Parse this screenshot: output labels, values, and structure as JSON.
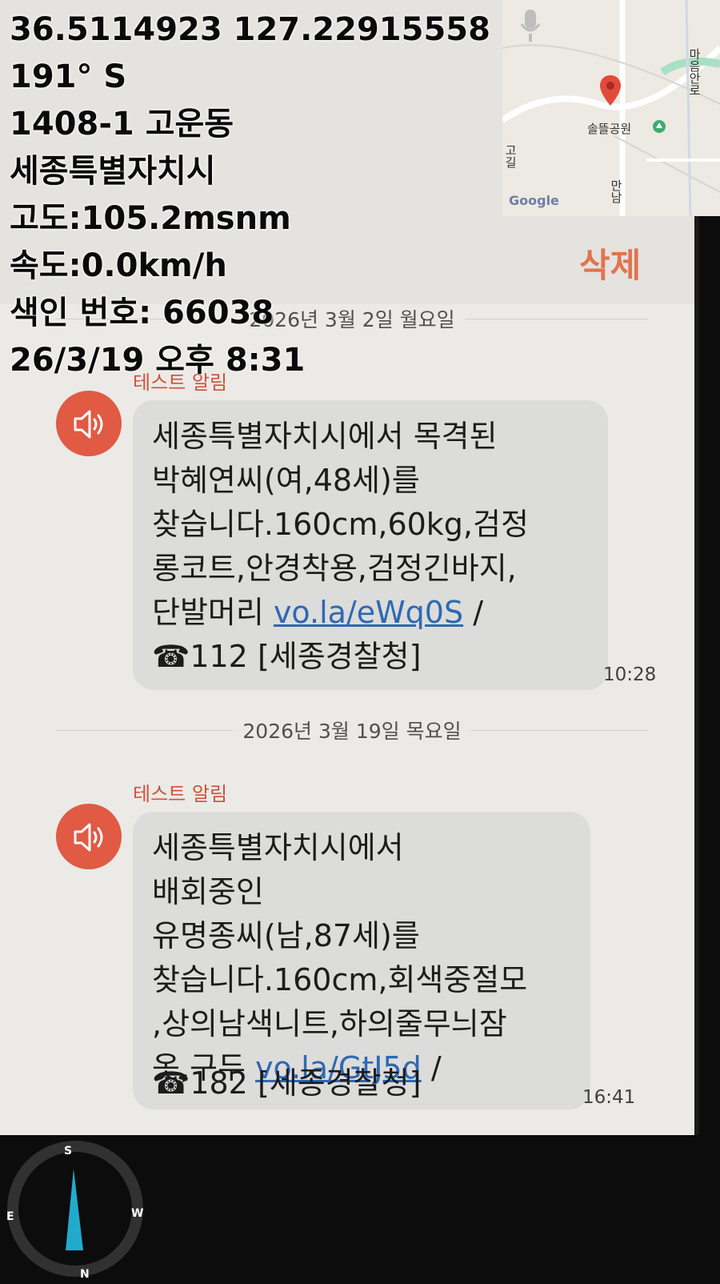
{
  "overlay": {
    "coordinates": "36.5114923 127.22915558",
    "heading": "191° S",
    "address": "1408-1 고운동",
    "city": "세종특별자치시",
    "altitude": "고도:105.2msnm",
    "speed": "속도:0.0km/h",
    "index": "색인 번호: 66038",
    "datetime": "26/3/19 오후 8:31"
  },
  "map": {
    "brand": "Google",
    "place": "솔뜰공원",
    "road_labels": [
      "마음안로",
      "고길",
      "만남"
    ]
  },
  "header": {
    "delete_label": "삭제"
  },
  "messages": [
    {
      "date": "2026년 3월 2일 월요일",
      "sender": "테스트 알림",
      "lines": [
        "세종특별자치시에서 목격된",
        "박혜연씨(여,48세)를",
        "찾습니다.160cm,60kg,검정",
        "롱코트,안경착용,검정긴바지,"
      ],
      "last_prefix": "단발머리",
      "link": "vo.la/eWq0S",
      "last_suffix": "/",
      "phone": "☎112 [세종경찰청]",
      "time": "10:28"
    },
    {
      "date": "2026년 3월 19일 목요일",
      "sender": "테스트 알림",
      "lines": [
        "세종특별자치시에서",
        "배회중인",
        "유명종씨(남,87세)를",
        "찾습니다.160cm,회색중절모",
        ",상의남색니트,하의줄무늬잠"
      ],
      "last_prefix": "옷,구두",
      "link": "vo.la/GtJ5d",
      "last_suffix": "/",
      "phone": "☎182 [세종경찰청]",
      "time": "16:41"
    }
  ],
  "compass": {
    "labels": [
      "S",
      "W",
      "N",
      "E"
    ],
    "heading_deg": 191
  },
  "colors": {
    "accent": "#e2734f",
    "avatar": "#e05a44",
    "link": "#2d69b5"
  }
}
